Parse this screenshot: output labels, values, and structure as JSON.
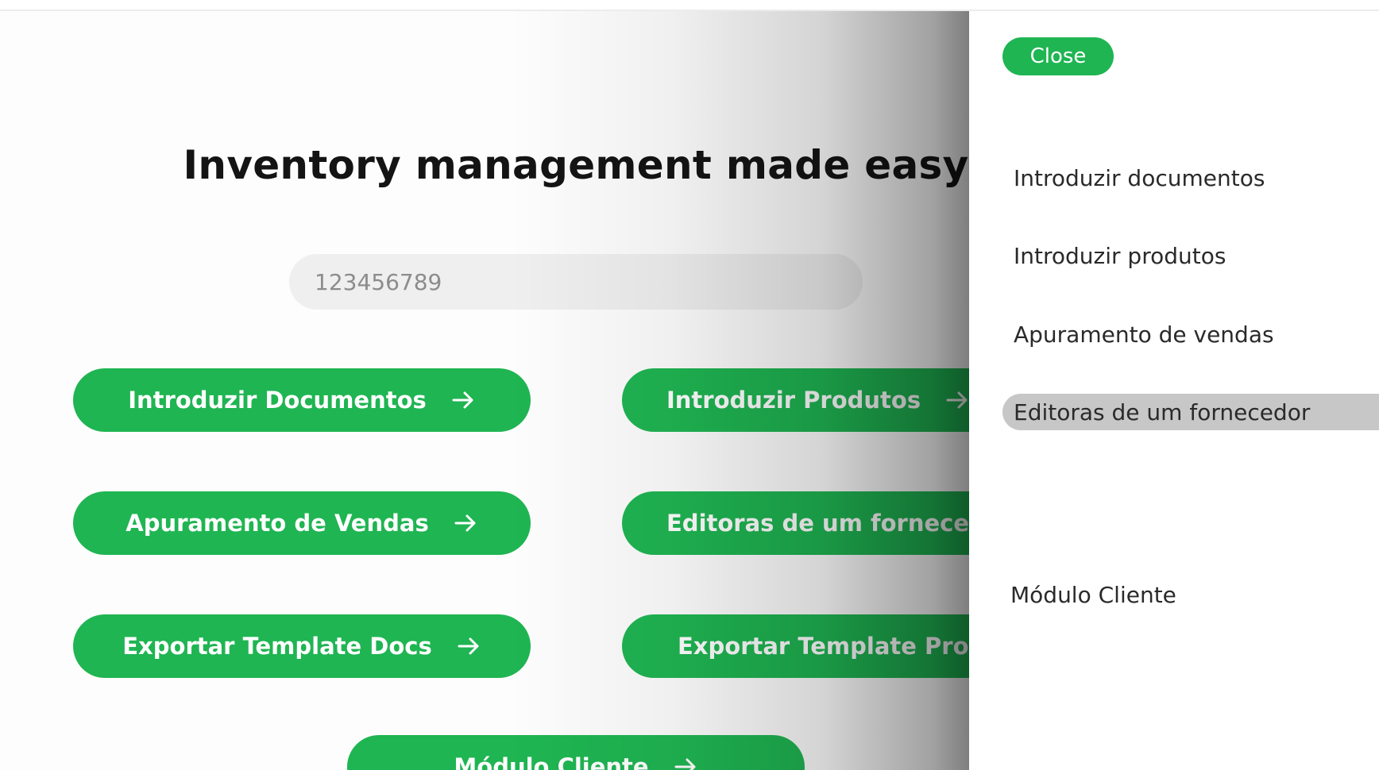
{
  "main": {
    "title": "Inventory management made easy",
    "search": {
      "value": "",
      "placeholder": "123456789"
    },
    "buttons": [
      {
        "label": "Introduzir Documentos"
      },
      {
        "label": "Introduzir Produtos"
      },
      {
        "label": "Apuramento de Vendas"
      },
      {
        "label": "Editoras de um fornecedor"
      },
      {
        "label": "Exportar Template Docs"
      },
      {
        "label": "Exportar Template Prods"
      },
      {
        "label": "Módulo Cliente"
      }
    ]
  },
  "side_panel": {
    "close_label": "Close",
    "items": [
      {
        "label": "Introduzir documentos"
      },
      {
        "label": "Introduzir produtos"
      },
      {
        "label": "Apuramento de vendas"
      },
      {
        "label": "Editoras de um fornecedor",
        "active": true
      },
      {
        "label": "Módulo Cliente"
      }
    ]
  },
  "colors": {
    "accent": "#1fb552",
    "active_item_bg": "#c7c7c7",
    "input_bg": "#efefef"
  },
  "icons": {
    "button_arrow": "arrow-right-icon"
  }
}
